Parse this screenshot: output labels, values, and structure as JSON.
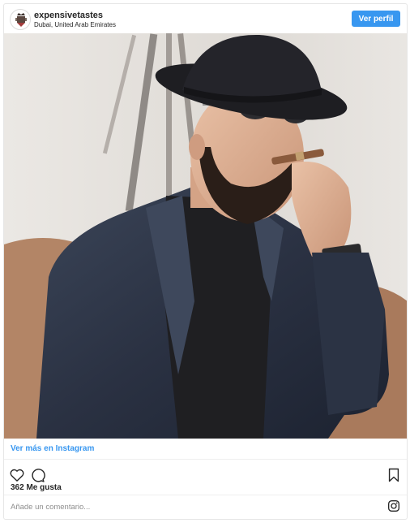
{
  "header": {
    "username": "expensivetastes",
    "location": "Dubai, United Arab Emirates",
    "profile_button": "Ver perfil",
    "avatar_icon": "crest-icon"
  },
  "post": {
    "photo_subject": "man-in-fedora-smoking-cigar"
  },
  "footer": {
    "more_link": "Ver más en Instagram",
    "likes_text": "362 Me gusta",
    "comment_placeholder": "Añade un comentario...",
    "icons": [
      "heart-icon",
      "comment-icon",
      "bookmark-icon",
      "instagram-icon"
    ]
  },
  "colors": {
    "accent": "#3897f0",
    "border": "#e6e6e6",
    "text": "#262626",
    "muted": "#8e8e8e"
  }
}
